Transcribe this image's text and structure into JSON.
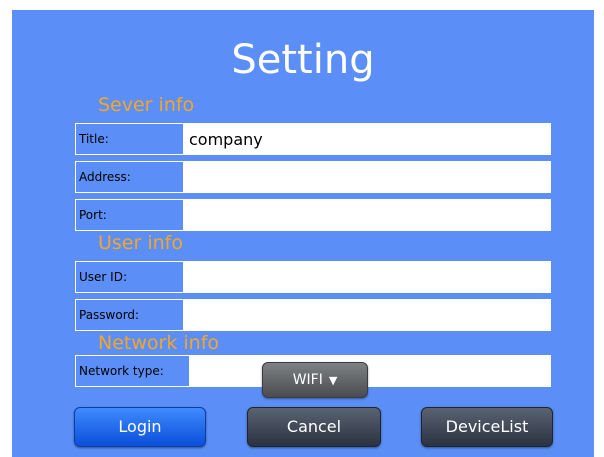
{
  "page": {
    "title": "Setting"
  },
  "sections": {
    "server": "Sever info",
    "user": "User info",
    "network": "Network info"
  },
  "server_fields": {
    "title_label": "Title:",
    "title_value": "company",
    "address_label": "Address:",
    "address_value": "",
    "port_label": "Port:",
    "port_value": ""
  },
  "user_fields": {
    "user_id_label": "User ID:",
    "user_id_value": "",
    "password_label": "Password:",
    "password_value": ""
  },
  "network_fields": {
    "type_label": "Network type:",
    "type_selected": "WIFI",
    "dropdown_icon": "triangle-down-icon"
  },
  "buttons": {
    "login": "Login",
    "cancel": "Cancel",
    "device_list": "DeviceList"
  },
  "colors": {
    "background": "#5b8ff7",
    "section_heading": "#f5a623",
    "login_button": "#1e6cf0",
    "dark_button": "#3a4250"
  }
}
